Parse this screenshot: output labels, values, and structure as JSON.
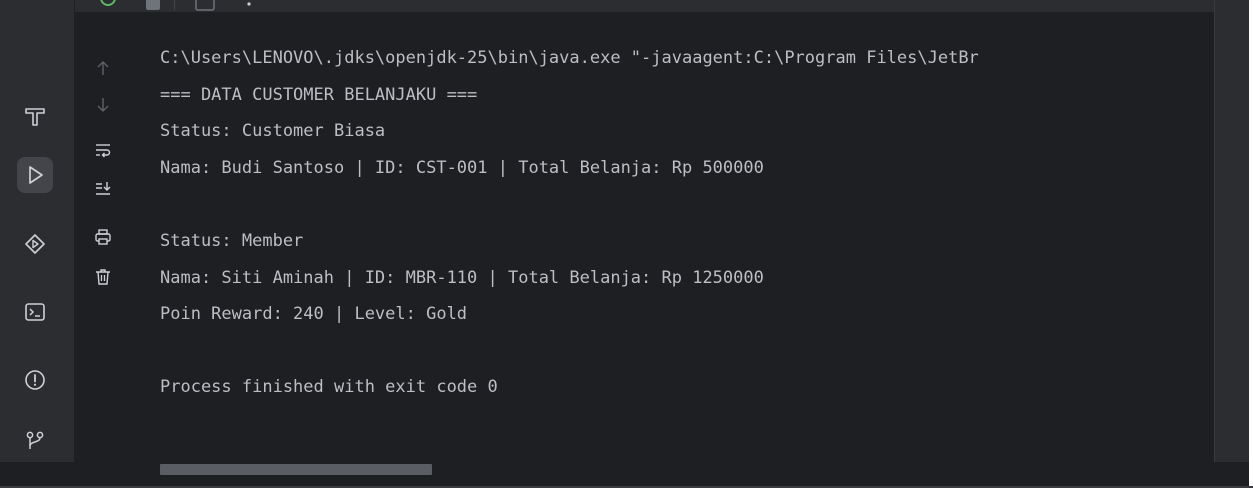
{
  "app": {
    "panel": "Run console"
  },
  "colors": {
    "background": "#1e1f22",
    "toolwindow": "#2b2d30",
    "text": "#bcbec4",
    "icon": "#ced0d6",
    "icon_disabled": "#5f6166",
    "active_button": "#43454a"
  },
  "sidebar": {
    "items": [
      {
        "name": "build-icon",
        "active": false
      },
      {
        "name": "run-icon",
        "active": true
      },
      {
        "name": "services-icon",
        "active": false
      },
      {
        "name": "terminal-icon",
        "active": false
      },
      {
        "name": "problems-icon",
        "active": false
      },
      {
        "name": "git-icon",
        "active": false
      }
    ]
  },
  "console_toolbar": {
    "items": [
      {
        "name": "scroll-up-icon",
        "enabled": false
      },
      {
        "name": "scroll-down-icon",
        "enabled": false
      },
      {
        "name": "soft-wrap-icon",
        "enabled": true
      },
      {
        "name": "scroll-to-end-icon",
        "enabled": true
      },
      {
        "name": "print-icon",
        "enabled": true
      },
      {
        "name": "clear-all-icon",
        "enabled": true
      }
    ]
  },
  "console": {
    "lines": [
      "C:\\Users\\LENOVO\\.jdks\\openjdk-25\\bin\\java.exe \"-javaagent:C:\\Program Files\\JetBr",
      "=== DATA CUSTOMER BELANJAKU ===",
      "Status: Customer Biasa",
      "Nama: Budi Santoso | ID: CST-001 | Total Belanja: Rp 500000",
      "",
      "Status: Member",
      "Nama: Siti Aminah | ID: MBR-110 | Total Belanja: Rp 1250000",
      "Poin Reward: 240 | Level: Gold",
      "",
      "Process finished with exit code 0"
    ]
  }
}
